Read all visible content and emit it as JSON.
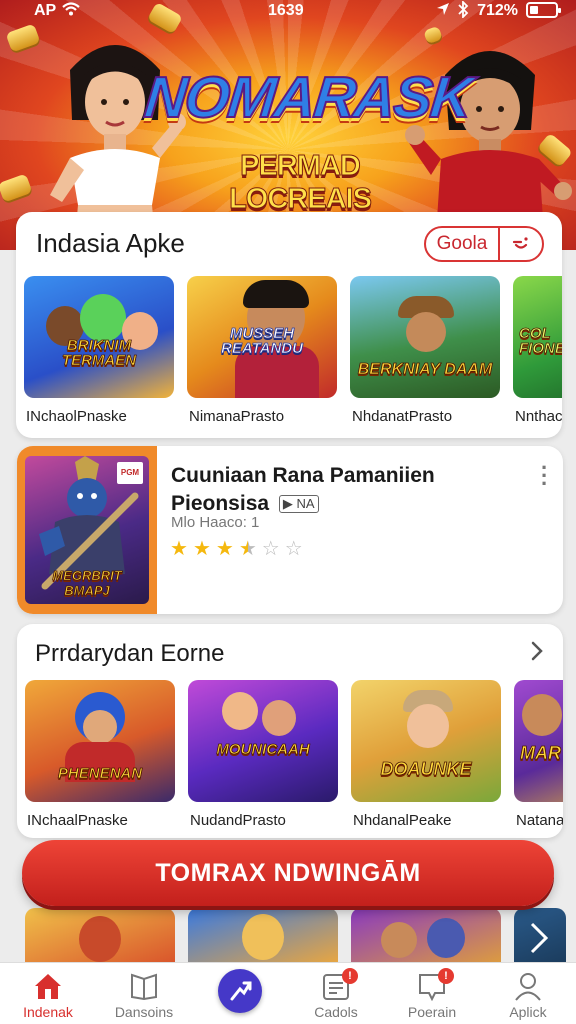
{
  "status_bar": {
    "carrier": "AP",
    "time": "1639",
    "battery": "712%"
  },
  "hero": {
    "logo": "NOMARASK",
    "subtitle": "PERMAD LOCREAIS"
  },
  "section_one": {
    "title": "Indasia Apke",
    "action_label": "Goola",
    "tiles": [
      {
        "label": "INchaolPnaske",
        "logo": "BRIKNIM TERMAEN",
        "palette": "a"
      },
      {
        "label": "NimanaPrasto",
        "logo": "MUSSEH REATANDU",
        "palette": "b"
      },
      {
        "label": "NhdanatPrasto",
        "logo": "BERKNIAY DAAM",
        "palette": "c"
      },
      {
        "label": "Nnthacio",
        "logo": "COL FIONE",
        "palette": "d"
      }
    ]
  },
  "featured": {
    "title": "Cuuniaan Rana Pamaniien Pieonsisa",
    "badge": "NA",
    "meta": "Mlo Haaco: 1",
    "rating": 3.5,
    "image_logo": "MEGRBRIT BMAPJ",
    "corner_tag": "PGM"
  },
  "section_two": {
    "title": "Prrdarydan Eorne",
    "tiles": [
      {
        "label": "INchaalPnaske",
        "logo": "PHENENAN",
        "palette": "e"
      },
      {
        "label": "NudandPrasto",
        "logo": "MOUNICAAH",
        "palette": "f"
      },
      {
        "label": "NhdanalPeake",
        "logo": "DOAUNKE",
        "palette": "g"
      },
      {
        "label": "Natana",
        "logo": "MAR",
        "palette": "h"
      }
    ]
  },
  "cta": {
    "label": "TOMRAX NDWINGĀM"
  },
  "bottom_nav": [
    {
      "label": "Indenak",
      "icon": "home-icon",
      "active": true
    },
    {
      "label": "Dansoins",
      "icon": "book-icon",
      "active": false
    },
    {
      "label": "",
      "icon": "compass-icon",
      "active": false
    },
    {
      "label": "Cadols",
      "icon": "document-icon",
      "active": false,
      "badge": "!"
    },
    {
      "label": "Poerain",
      "icon": "message-icon",
      "active": false,
      "badge": "!"
    },
    {
      "label": "Aplick",
      "icon": "profile-icon",
      "active": false
    }
  ],
  "colors": {
    "accent": "#d8302e",
    "cta": "#e23b2f",
    "nav_center": "#4538c8",
    "star": "#f5b80e"
  }
}
